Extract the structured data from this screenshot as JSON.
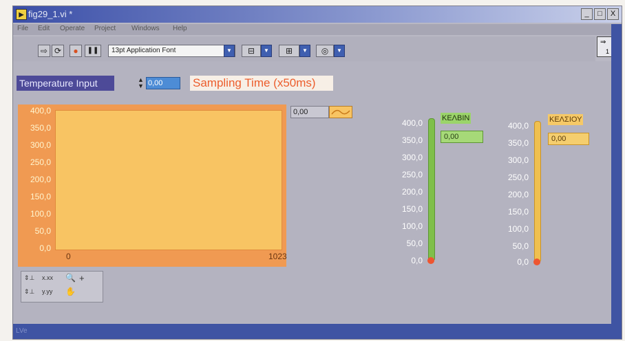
{
  "window": {
    "title": "fig29_1.vi *",
    "buttons": [
      "_",
      "□",
      "X"
    ]
  },
  "menu": [
    "File",
    "Edit",
    "Operate",
    "Project",
    "Windows",
    "Help"
  ],
  "toolbar": {
    "run": "⇨",
    "run_continuous": "⟳",
    "abort": "●",
    "pause": "❚❚",
    "font": "13pt Application Font"
  },
  "connector": {
    "label": "1"
  },
  "controls": {
    "temperature_input_label": "Temperature Input",
    "sampling_value": "0,00",
    "sampling_label": "Sampling Time (x50ms)"
  },
  "chart": {
    "legend_value": "0,00",
    "y_ticks": [
      "400,0",
      "350,0",
      "300,0",
      "250,0",
      "200,0",
      "150,0",
      "100,0",
      "50,0",
      "0,0"
    ],
    "x_min": "0",
    "x_max": "1023"
  },
  "chart_data": {
    "type": "line",
    "title": "",
    "xlabel": "",
    "ylabel": "",
    "xlim": [
      0,
      1023
    ],
    "ylim": [
      0,
      400
    ],
    "series": []
  },
  "thermometers": {
    "kelvin": {
      "label": "ΚΕΛΒΙΝ",
      "value": "0,00",
      "level": 0,
      "color": "#7fbf4a",
      "scale": [
        "400,0",
        "350,0",
        "300,0",
        "250,0",
        "200,0",
        "150,0",
        "100,0",
        "50,0",
        "0,0"
      ]
    },
    "celsius": {
      "label": "ΚΕΛΣΙΟΥ",
      "value": "0,00",
      "level": 0,
      "color": "#f0c050",
      "scale": [
        "400,0",
        "350,0",
        "300,0",
        "250,0",
        "200,0",
        "150,0",
        "100,0",
        "50,0",
        "0,0"
      ]
    }
  },
  "statusbar": {
    "label": "LVe"
  }
}
